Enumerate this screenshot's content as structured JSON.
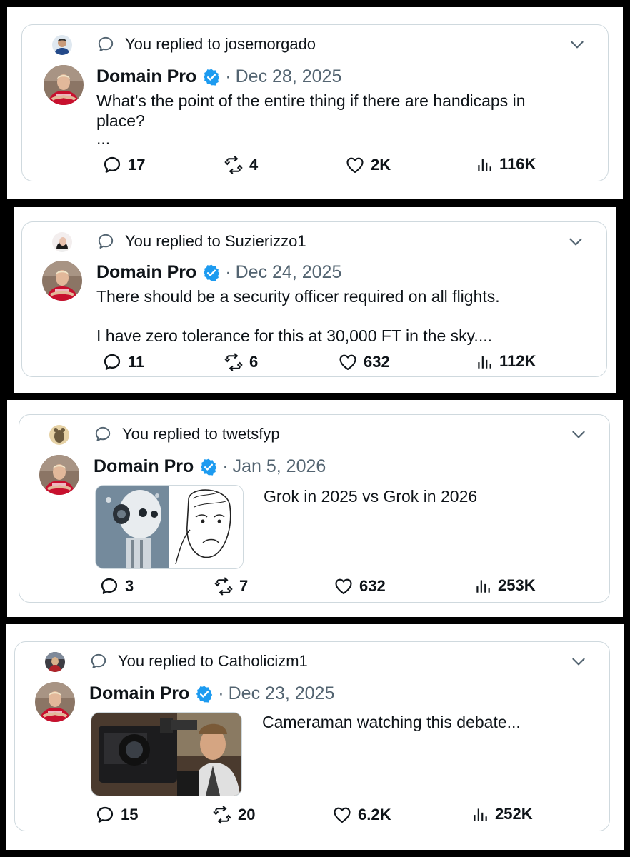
{
  "colors": {
    "background": "#000000",
    "card_border": "#cfd9de",
    "secondary_text": "#536471",
    "verified_badge": "#1d9bf0"
  },
  "icons": {
    "reply": "reply-bubble-icon",
    "retweet": "retweet-icon",
    "like": "heart-icon",
    "views": "bar-chart-icon",
    "verified": "verified-badge-icon",
    "more": "chevron-down-icon"
  },
  "tweets": [
    {
      "replied_to": "You replied to josemorgado",
      "author": "Domain Pro",
      "separator": "·",
      "date": "Dec 28, 2025",
      "text_lines": [
        "What’s the point of the entire thing if there are handicaps in",
        "place?",
        "..."
      ],
      "replies": "17",
      "retweets": "4",
      "likes": "2K",
      "views": "116K"
    },
    {
      "replied_to": "You replied to Suzierizzo1",
      "author": "Domain Pro",
      "separator": "·",
      "date": "Dec 24, 2025",
      "text_lines": [
        "There should be a security officer required on all flights.",
        "I have zero tolerance for this at 30,000 FT in the sky...."
      ],
      "replies": "11",
      "retweets": "6",
      "likes": "632",
      "views": "112K"
    },
    {
      "replied_to": "You replied to twetsfyp",
      "author": "Domain Pro",
      "separator": "·",
      "date": "Jan 5, 2026",
      "text_lines": [
        "Grok in 2025 vs Grok in 2026"
      ],
      "media": "robot-and-sad-wojak-image",
      "replies": "3",
      "retweets": "7",
      "likes": "632",
      "views": "253K"
    },
    {
      "replied_to": "You replied to Catholicizm1",
      "author": "Domain Pro",
      "separator": "·",
      "date": "Dec 23, 2025",
      "text_lines": [
        "Cameraman watching this debate..."
      ],
      "media": "cameraman-image",
      "replies": "15",
      "retweets": "20",
      "likes": "6.2K",
      "views": "252K"
    }
  ]
}
